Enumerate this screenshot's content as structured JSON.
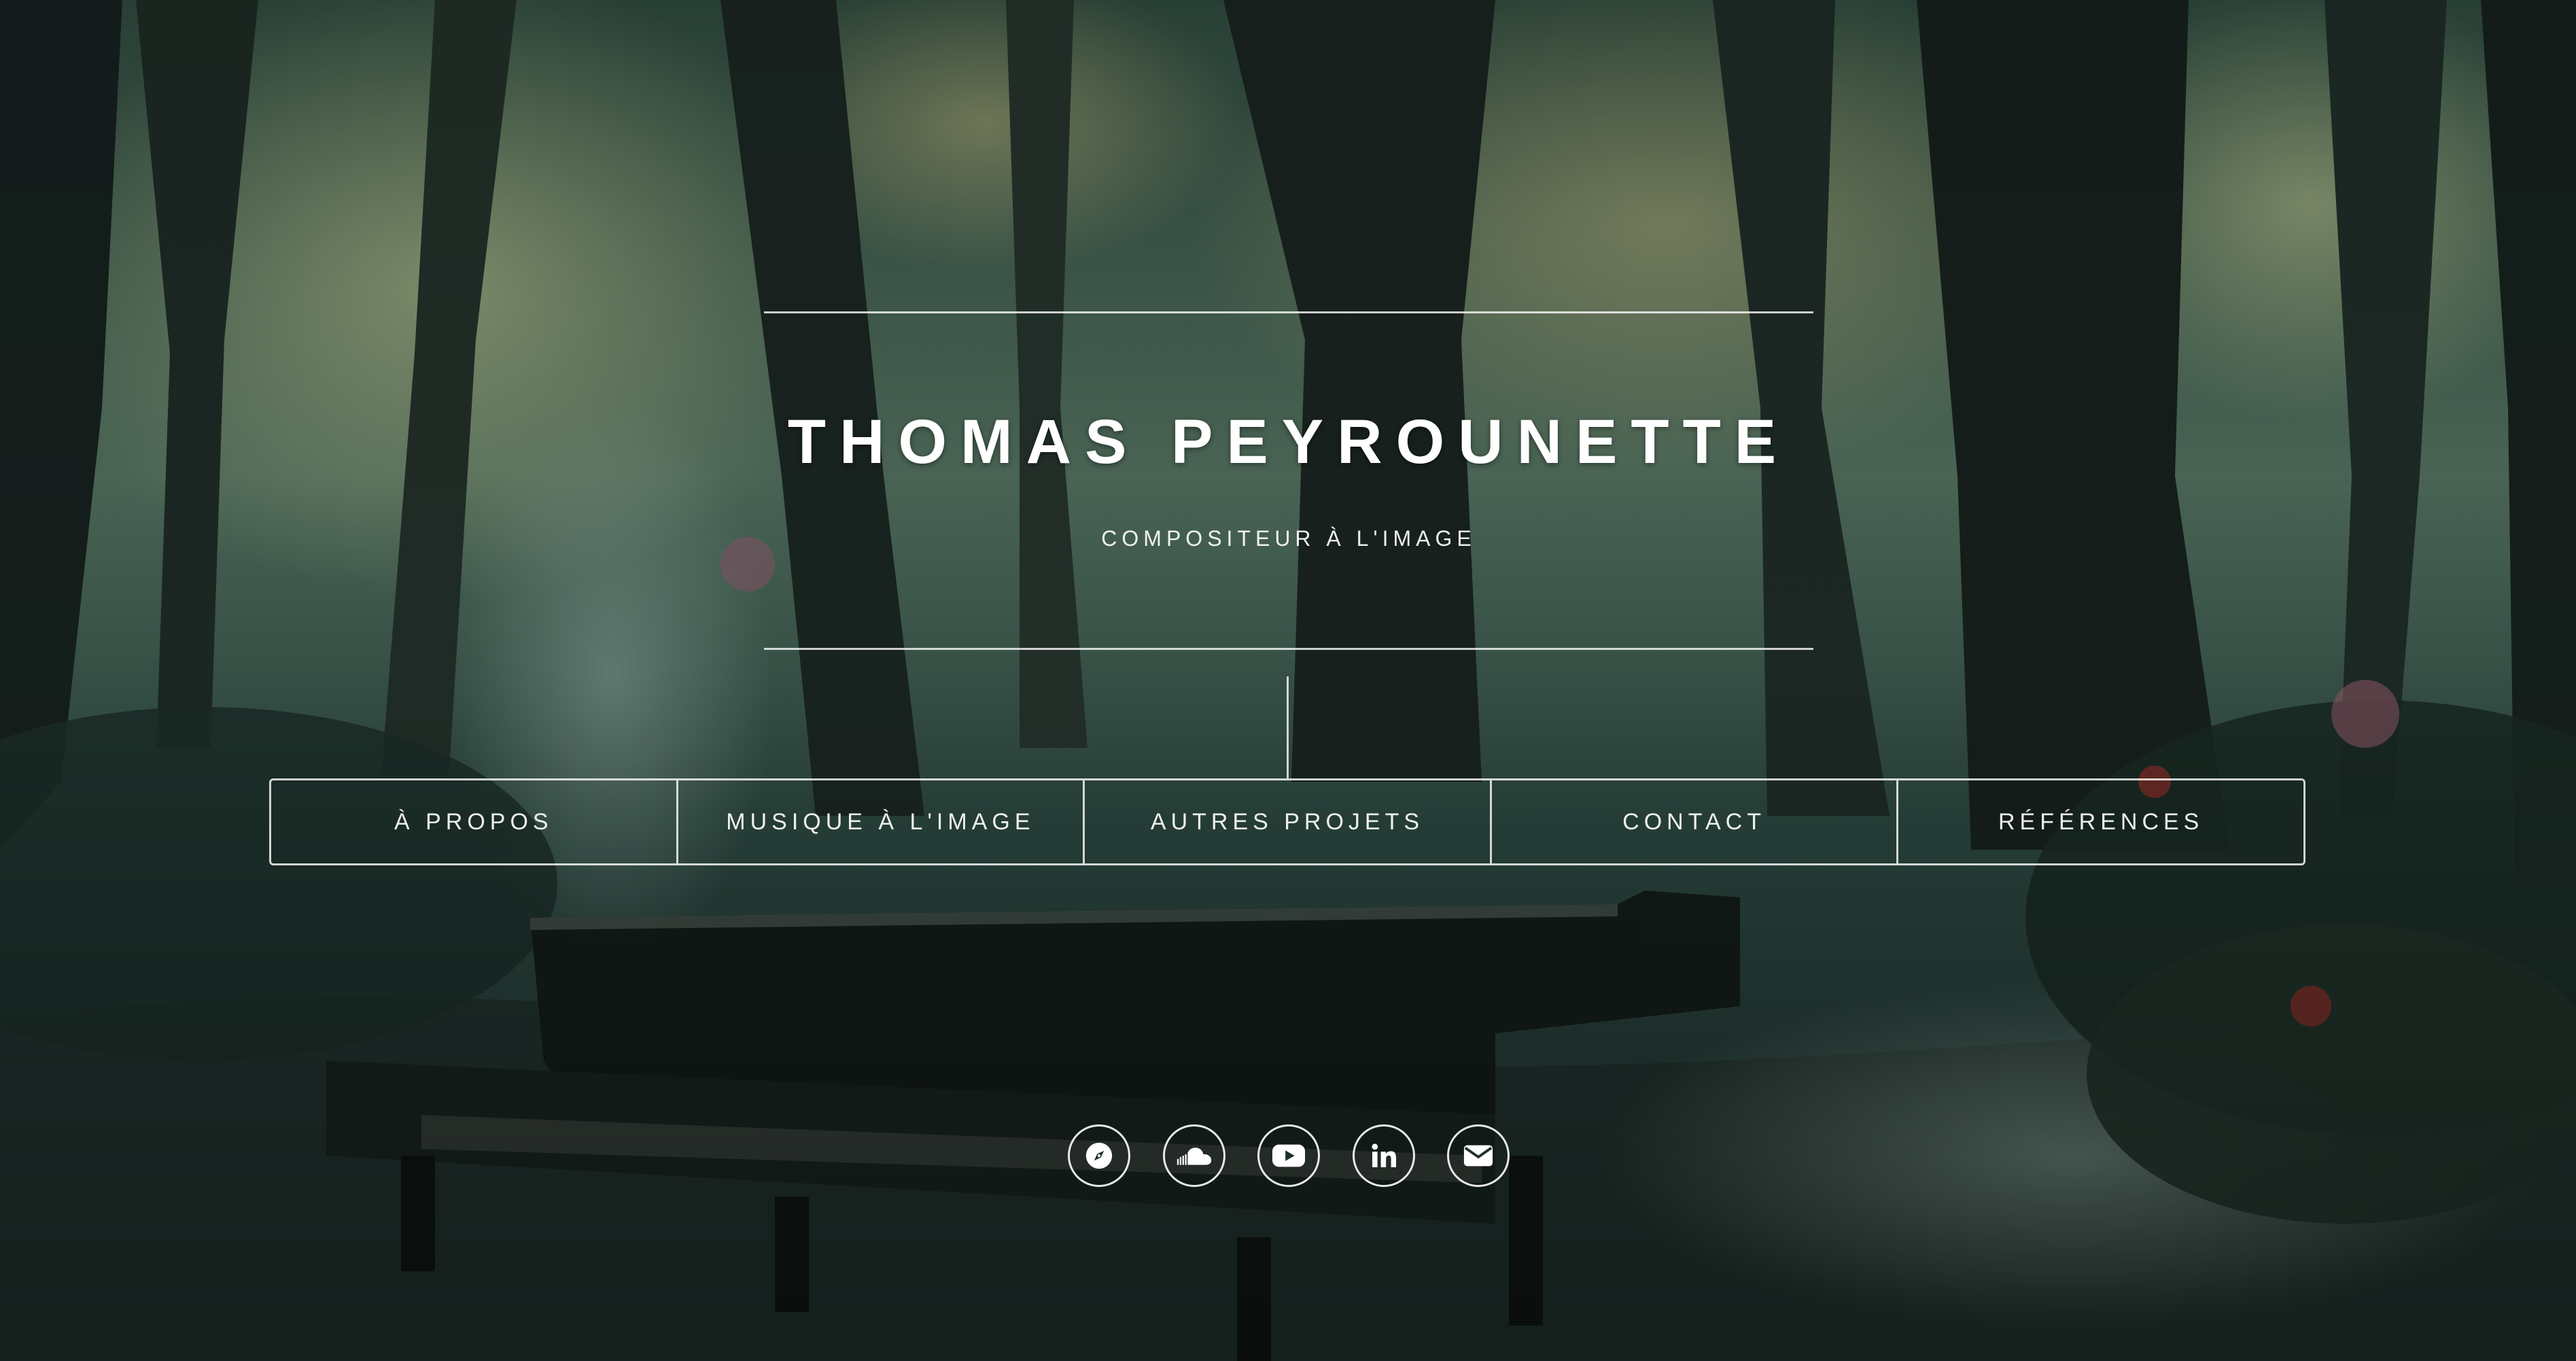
{
  "header": {
    "title": "THOMAS PEYROUNETTE",
    "subtitle": "COMPOSITEUR À L'IMAGE"
  },
  "nav": {
    "items": [
      {
        "label": "À PROPOS"
      },
      {
        "label": "MUSIQUE À L'IMAGE"
      },
      {
        "label": "AUTRES PROJETS"
      },
      {
        "label": "CONTACT"
      },
      {
        "label": "RÉFÉRENCES"
      }
    ]
  },
  "social": {
    "icons": [
      "compass-icon",
      "soundcloud-icon",
      "youtube-icon",
      "linkedin-icon",
      "envelope-icon"
    ]
  },
  "colors": {
    "text": "#ffffff",
    "line": "#ffffffcc",
    "background_base": "#1b302c"
  }
}
